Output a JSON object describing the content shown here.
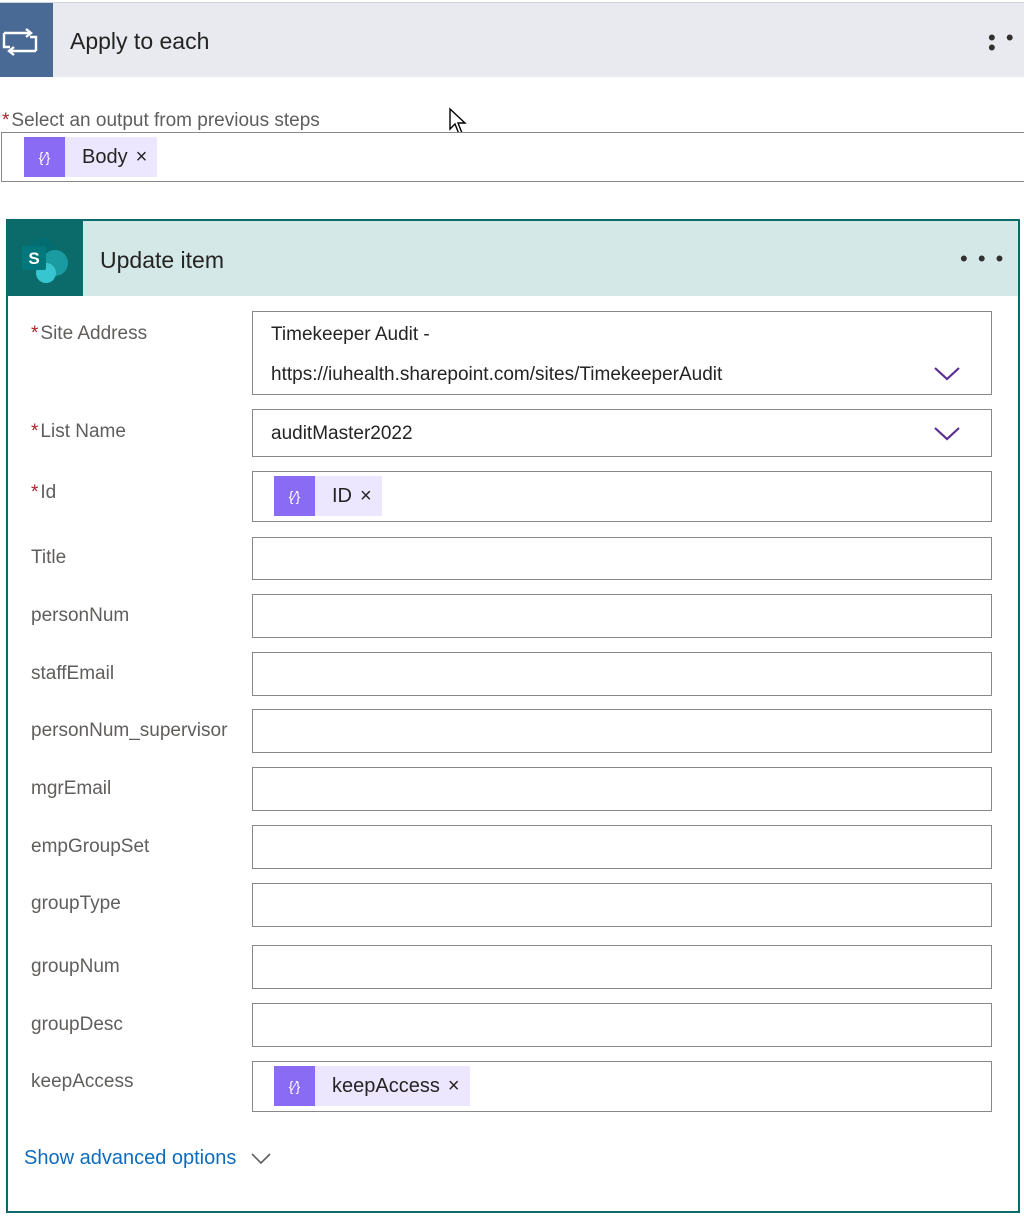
{
  "apply_to_each": {
    "title": "Apply to each",
    "icon": "loop-icon",
    "menu_icon": "more-icon",
    "select_label": "Select an output from previous steps",
    "required_mark": "*",
    "selected_token": "Body",
    "token_remove": "×"
  },
  "update_item": {
    "title": "Update item",
    "icon": "sharepoint-icon",
    "icon_letter": "S",
    "menu_icon": "more-icon",
    "fields": {
      "site_address": {
        "label": "Site Address",
        "value_line1": "Timekeeper Audit -",
        "value_line2": "https://iuhealth.sharepoint.com/sites/TimekeeperAudit"
      },
      "list_name": {
        "label": "List Name",
        "value": "auditMaster2022"
      },
      "id": {
        "label": "Id",
        "token": "ID"
      },
      "title": {
        "label": "Title",
        "value": ""
      },
      "personNum": {
        "label": "personNum",
        "value": ""
      },
      "staffEmail": {
        "label": "staffEmail",
        "value": ""
      },
      "personNum_supervisor": {
        "label": "personNum_supervisor",
        "value": ""
      },
      "mgrEmail": {
        "label": "mgrEmail",
        "value": ""
      },
      "empGroupSet": {
        "label": "empGroupSet",
        "value": ""
      },
      "groupType": {
        "label": "groupType",
        "value": ""
      },
      "groupNum": {
        "label": "groupNum",
        "value": ""
      },
      "groupDesc": {
        "label": "groupDesc",
        "value": ""
      },
      "keepAccess": {
        "label": "keepAccess",
        "token": "keepAccess"
      }
    },
    "show_advanced": "Show advanced options"
  },
  "colors": {
    "apply_header_bg": "#e8eaf0",
    "apply_icon_bg": "#4a6a96",
    "card_border": "#0b6a6a",
    "card_header_bg": "#d5e8e8",
    "token_icon_bg": "#8a6bf4",
    "token_bg": "#ece6ff",
    "required": "#a4262c",
    "link": "#0f6cbd",
    "chevron": "#5c2d91"
  }
}
